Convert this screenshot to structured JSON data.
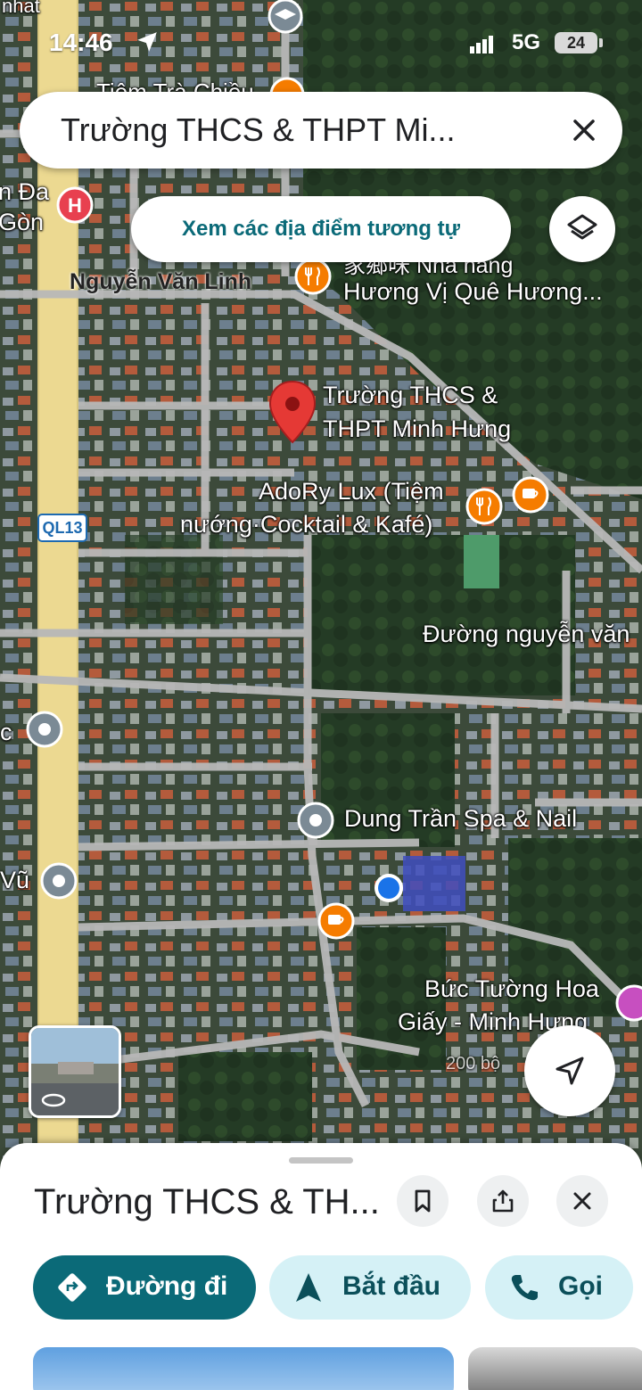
{
  "status_bar": {
    "time": "14:46",
    "network": "5G",
    "battery": "24"
  },
  "search": {
    "query": "Trường THCS & THPT Mi..."
  },
  "similar_button": {
    "label": "Xem các địa điểm tương tự"
  },
  "map": {
    "labels": {
      "top_left": "nhat",
      "partial_place": "Tiệm Trà Chiều",
      "hospital": "n Đa\nGòn",
      "road_main": "Nguyễn Văn Linh",
      "restaurant_line1": "家鄉味 Nhà hàng",
      "restaurant_line2": "Hương Vị Quê Hương...",
      "school_line1": "Trường THCS &",
      "school_line2": "THPT Minh Hưng",
      "adory_line1": "AdoRy Lux (Tiệm",
      "adory_line2": "nướng·Cocktail & Kafé)",
      "road_badge": "QL13",
      "road_right": "Đường nguyễn văn",
      "left_c": "c",
      "spa": "Dung Trần Spa & Nail",
      "left_vu": "Vũ",
      "wall_line1": "Bức Tường Hoa",
      "wall_line2": "Giấy - Minh Hưng",
      "scale": "200 bộ"
    },
    "colors": {
      "pin_red": "#e53935",
      "poi_orange": "#f57c00",
      "poi_gray": "#7b8a95",
      "hospital": "#e8404f",
      "blue_dot": "#1a73e8"
    }
  },
  "bottom_sheet": {
    "title": "Trường THCS & TH...",
    "actions": {
      "directions": "Đường đi",
      "start": "Bắt đầu",
      "call": "Gọi"
    },
    "colors": {
      "primary": "#0b6a78",
      "secondary_bg": "#d5f1f6"
    }
  }
}
